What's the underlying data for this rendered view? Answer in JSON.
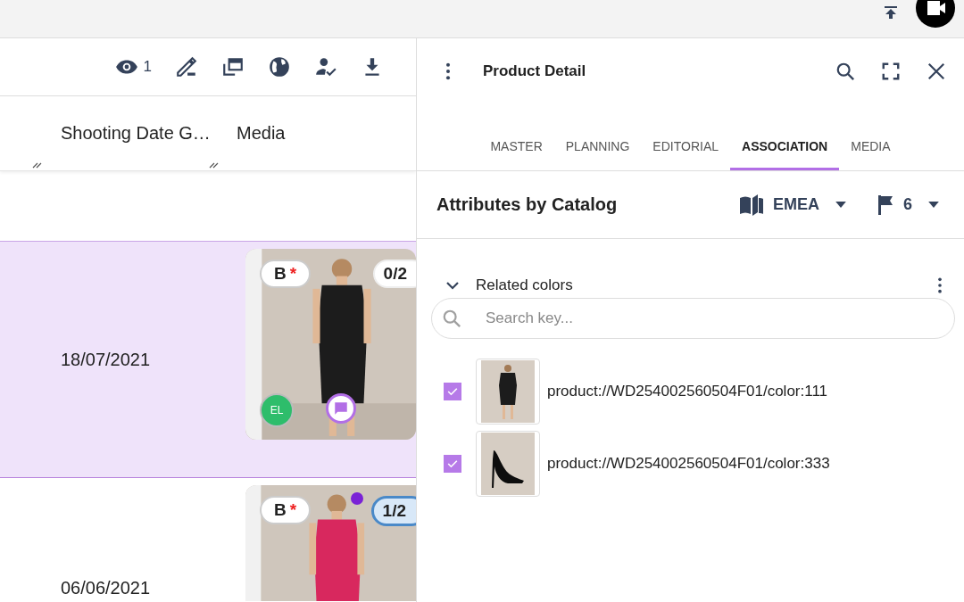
{
  "toolbar": {
    "view_count": "1"
  },
  "table": {
    "columns": [
      "Shooting Date G…",
      "Media"
    ],
    "rows": [
      {
        "date": "18/07/2021",
        "selected": true,
        "media": {
          "grade": "B",
          "mark": "*",
          "count": "0/2",
          "count_highlighted": false,
          "avatar": "EL",
          "comment": true
        }
      },
      {
        "date": "06/06/2021",
        "selected": false,
        "media": {
          "grade": "B",
          "mark": "*",
          "count": "1/2",
          "count_highlighted": true,
          "new_dot": true
        }
      }
    ]
  },
  "panel": {
    "title": "Product Detail",
    "tabs": [
      {
        "label": "MASTER",
        "selected": false
      },
      {
        "label": "PLANNING",
        "selected": false
      },
      {
        "label": "EDITORIAL",
        "selected": false
      },
      {
        "label": "ASSOCIATION",
        "selected": true
      },
      {
        "label": "MEDIA",
        "selected": false
      }
    ],
    "section_title": "Attributes by Catalog",
    "catalog": "EMEA",
    "flag_count": "6",
    "group": {
      "title": "Related colors",
      "expanded": true,
      "search": {
        "placeholder": "Search key..."
      },
      "items": [
        {
          "key": "product://WD254002560504F01/color:111",
          "checked": true,
          "kind": "dress"
        },
        {
          "key": "product://WD254002560504F01/color:333",
          "checked": true,
          "kind": "shoe"
        }
      ]
    }
  }
}
